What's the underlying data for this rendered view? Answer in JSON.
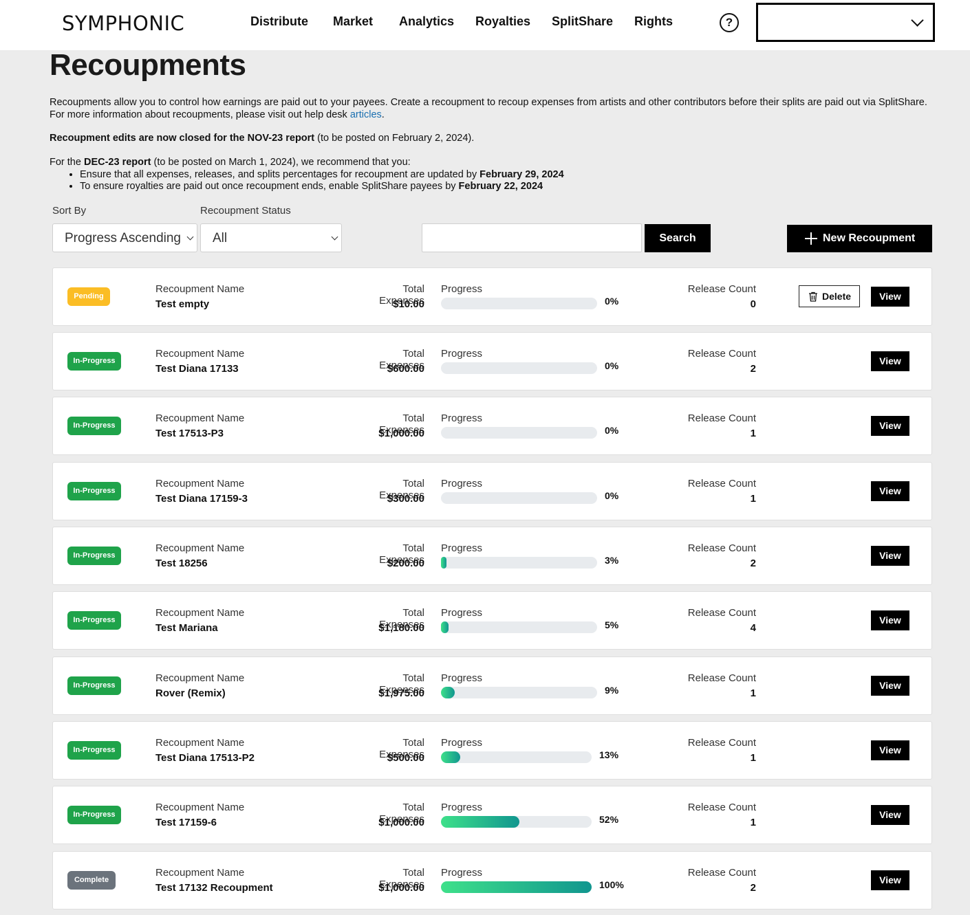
{
  "header": {
    "logo": "SYMPHONIC",
    "nav": [
      "Distribute",
      "Market",
      "Analytics",
      "Royalties",
      "SplitShare",
      "Rights"
    ],
    "help": "?"
  },
  "page": {
    "title": "Recoupments",
    "intro": "Recoupments allow you to control how earnings are paid out to your payees. Create a recoupment to recoup expenses from artists and other contributors before their splits are paid out via SplitShare. For more information about recoupments, please visit out help desk ",
    "intro_link": "articles",
    "intro_end": ".",
    "notice_bold": "Recoupment edits are now closed for the NOV-23 report",
    "notice_rest": " (to be posted on February 2, 2024).",
    "dec_prefix": "For the ",
    "dec_bold": "DEC-23 report",
    "dec_rest": " (to be posted on March 1, 2024), we recommend that you:",
    "bullet1_text": "Ensure that all expenses, releases, and splits percentages for recoupment are updated by ",
    "bullet1_date": "February 29, 2024",
    "bullet2_text": "To ensure royalties are paid out once recoupment ends, enable SplitShare payees by ",
    "bullet2_date": "February 22, 2024"
  },
  "filters": {
    "sort_label": "Sort By",
    "sort_value": "Progress Ascending",
    "status_label": "Recoupment Status",
    "status_value": "All",
    "search_value": "",
    "search_button": "Search",
    "new_button": "New Recoupment"
  },
  "labels": {
    "name": "Recoupment Name",
    "expenses": "Total Expenses",
    "progress": "Progress",
    "release_count": "Release Count",
    "delete": "Delete",
    "view": "View"
  },
  "recoupments": [
    {
      "status": "Pending",
      "name": "Test empty",
      "expenses": "$10.00",
      "progress": 0,
      "progress_text": "0%",
      "release_count": "0",
      "deletable": true
    },
    {
      "status": "In-Progress",
      "name": "Test Diana 17133",
      "expenses": "$600.00",
      "progress": 0,
      "progress_text": "0%",
      "release_count": "2"
    },
    {
      "status": "In-Progress",
      "name": "Test 17513-P3",
      "expenses": "$1,000.00",
      "progress": 0,
      "progress_text": "0%",
      "release_count": "1"
    },
    {
      "status": "In-Progress",
      "name": "Test Diana 17159-3",
      "expenses": "$300.00",
      "progress": 0,
      "progress_text": "0%",
      "release_count": "1"
    },
    {
      "status": "In-Progress",
      "name": "Test 18256",
      "expenses": "$200.00",
      "progress": 3,
      "progress_text": "3%",
      "release_count": "2"
    },
    {
      "status": "In-Progress",
      "name": "Test Mariana",
      "expenses": "$1,180.00",
      "progress": 5,
      "progress_text": "5%",
      "release_count": "4"
    },
    {
      "status": "In-Progress",
      "name": "Rover (Remix)",
      "expenses": "$1,975.00",
      "progress": 9,
      "progress_text": "9%",
      "release_count": "1"
    },
    {
      "status": "In-Progress",
      "name": "Test Diana 17513-P2",
      "expenses": "$500.00",
      "progress": 13,
      "progress_text": "13%",
      "release_count": "1"
    },
    {
      "status": "In-Progress",
      "name": "Test 17159-6",
      "expenses": "$1,000.00",
      "progress": 52,
      "progress_text": "52%",
      "release_count": "1"
    },
    {
      "status": "Complete",
      "name": "Test 17132 Recoupment",
      "expenses": "$1,000.00",
      "progress": 100,
      "progress_text": "100%",
      "release_count": "2"
    }
  ]
}
